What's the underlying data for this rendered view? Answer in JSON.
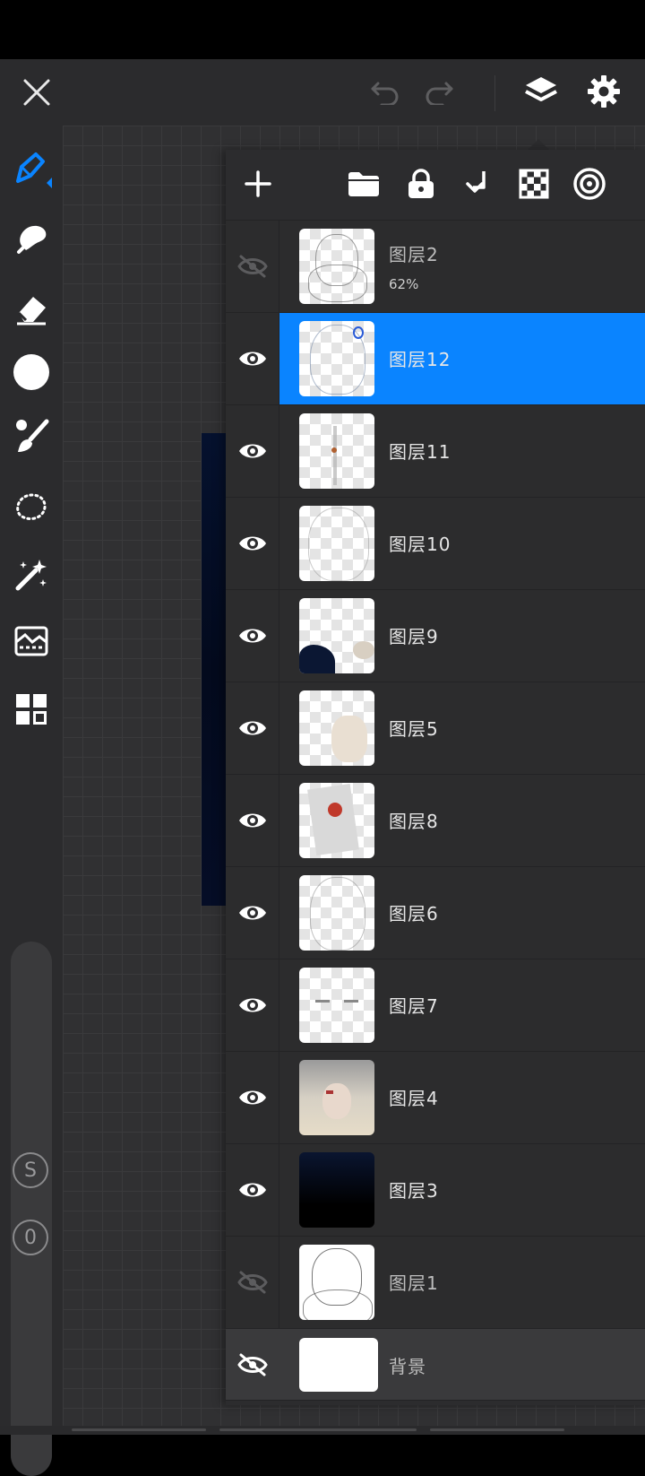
{
  "app": {
    "topbar": {
      "close_icon": "close-icon",
      "undo_icon": "undo-icon",
      "redo_icon": "redo-icon",
      "layers_icon": "layers-icon",
      "settings_icon": "gear-icon"
    },
    "toolbar": {
      "tools": [
        "pen-icon",
        "smudge-icon",
        "eraser-icon",
        "color-icon",
        "brush-settings-icon",
        "lasso-icon",
        "magic-wand-icon",
        "image-adjust-icon",
        "grid-apps-icon"
      ],
      "slider_badges": [
        "S",
        "0"
      ]
    },
    "colors": {
      "accent": "#0a84ff",
      "panel": "#2c2c2e",
      "toolbar": "#2b2b2d",
      "brush_color": "#ffffff"
    }
  },
  "layers_panel": {
    "header_icons": [
      "add-layer-icon",
      "folder-icon",
      "lock-icon",
      "merge-down-icon",
      "transparency-checker-icon",
      "target-icon"
    ],
    "layers": [
      {
        "name": "图层2",
        "opacity": "62%",
        "visible": false,
        "selected": false
      },
      {
        "name": "图层12",
        "visible": true,
        "selected": true
      },
      {
        "name": "图层11",
        "visible": true,
        "selected": false
      },
      {
        "name": "图层10",
        "visible": true,
        "selected": false
      },
      {
        "name": "图层9",
        "visible": true,
        "selected": false
      },
      {
        "name": "图层5",
        "visible": true,
        "selected": false
      },
      {
        "name": "图层8",
        "visible": true,
        "selected": false
      },
      {
        "name": "图层6",
        "visible": true,
        "selected": false
      },
      {
        "name": "图层7",
        "visible": true,
        "selected": false
      },
      {
        "name": "图层4",
        "visible": true,
        "selected": false
      },
      {
        "name": "图层3",
        "visible": true,
        "selected": false
      },
      {
        "name": "图层1",
        "visible": false,
        "selected": false
      }
    ],
    "background": {
      "name": "背景",
      "visible": false
    }
  }
}
